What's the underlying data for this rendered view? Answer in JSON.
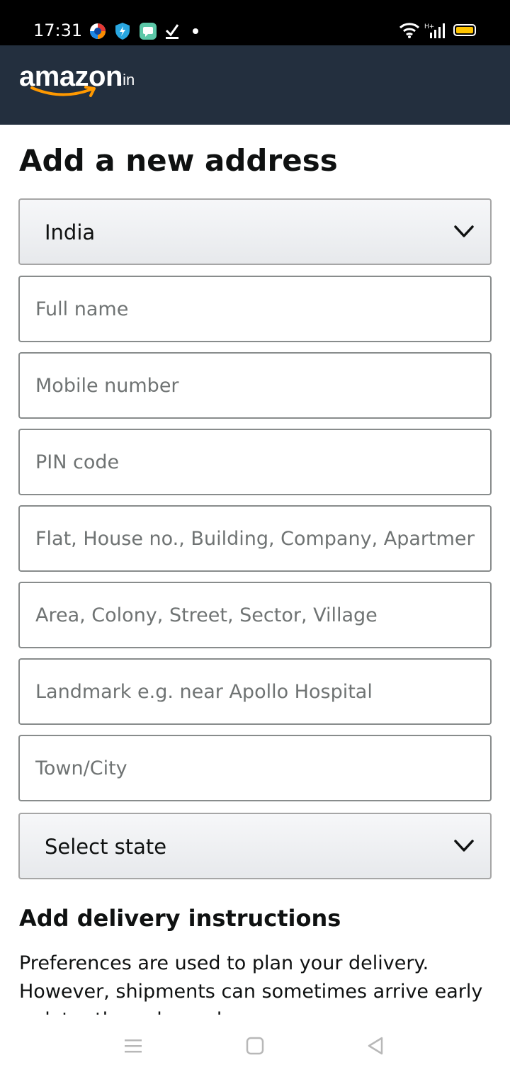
{
  "status_bar": {
    "time": "17:31",
    "icons": [
      "browser-icon",
      "shield-icon",
      "message-icon",
      "checkmark-icon",
      "dot-icon",
      "wifi-icon",
      "signal-icon",
      "battery-icon"
    ],
    "network_label": "H+",
    "battery_color": "#ffc400"
  },
  "header": {
    "logo_word": "amazon",
    "logo_tld": ".in",
    "background": "#232f3e",
    "smile_color": "#ff9900"
  },
  "form": {
    "title": "Add a new address",
    "country": "India",
    "full_name_placeholder": "Full name",
    "mobile_placeholder": "Mobile number",
    "pin_placeholder": "PIN code",
    "flat_placeholder": "Flat, House no., Building, Company, Apartment",
    "area_placeholder": "Area, Colony, Street, Sector, Village",
    "landmark_placeholder": "Landmark e.g. near Apollo Hospital",
    "city_placeholder": "Town/City",
    "state": "Select state"
  },
  "delivery": {
    "heading": "Add delivery instructions",
    "text": "Preferences are used to plan your delivery. However, shipments can sometimes arrive early or later than planned."
  },
  "nav": {
    "buttons": [
      "menu-icon",
      "home-icon",
      "back-icon"
    ]
  }
}
